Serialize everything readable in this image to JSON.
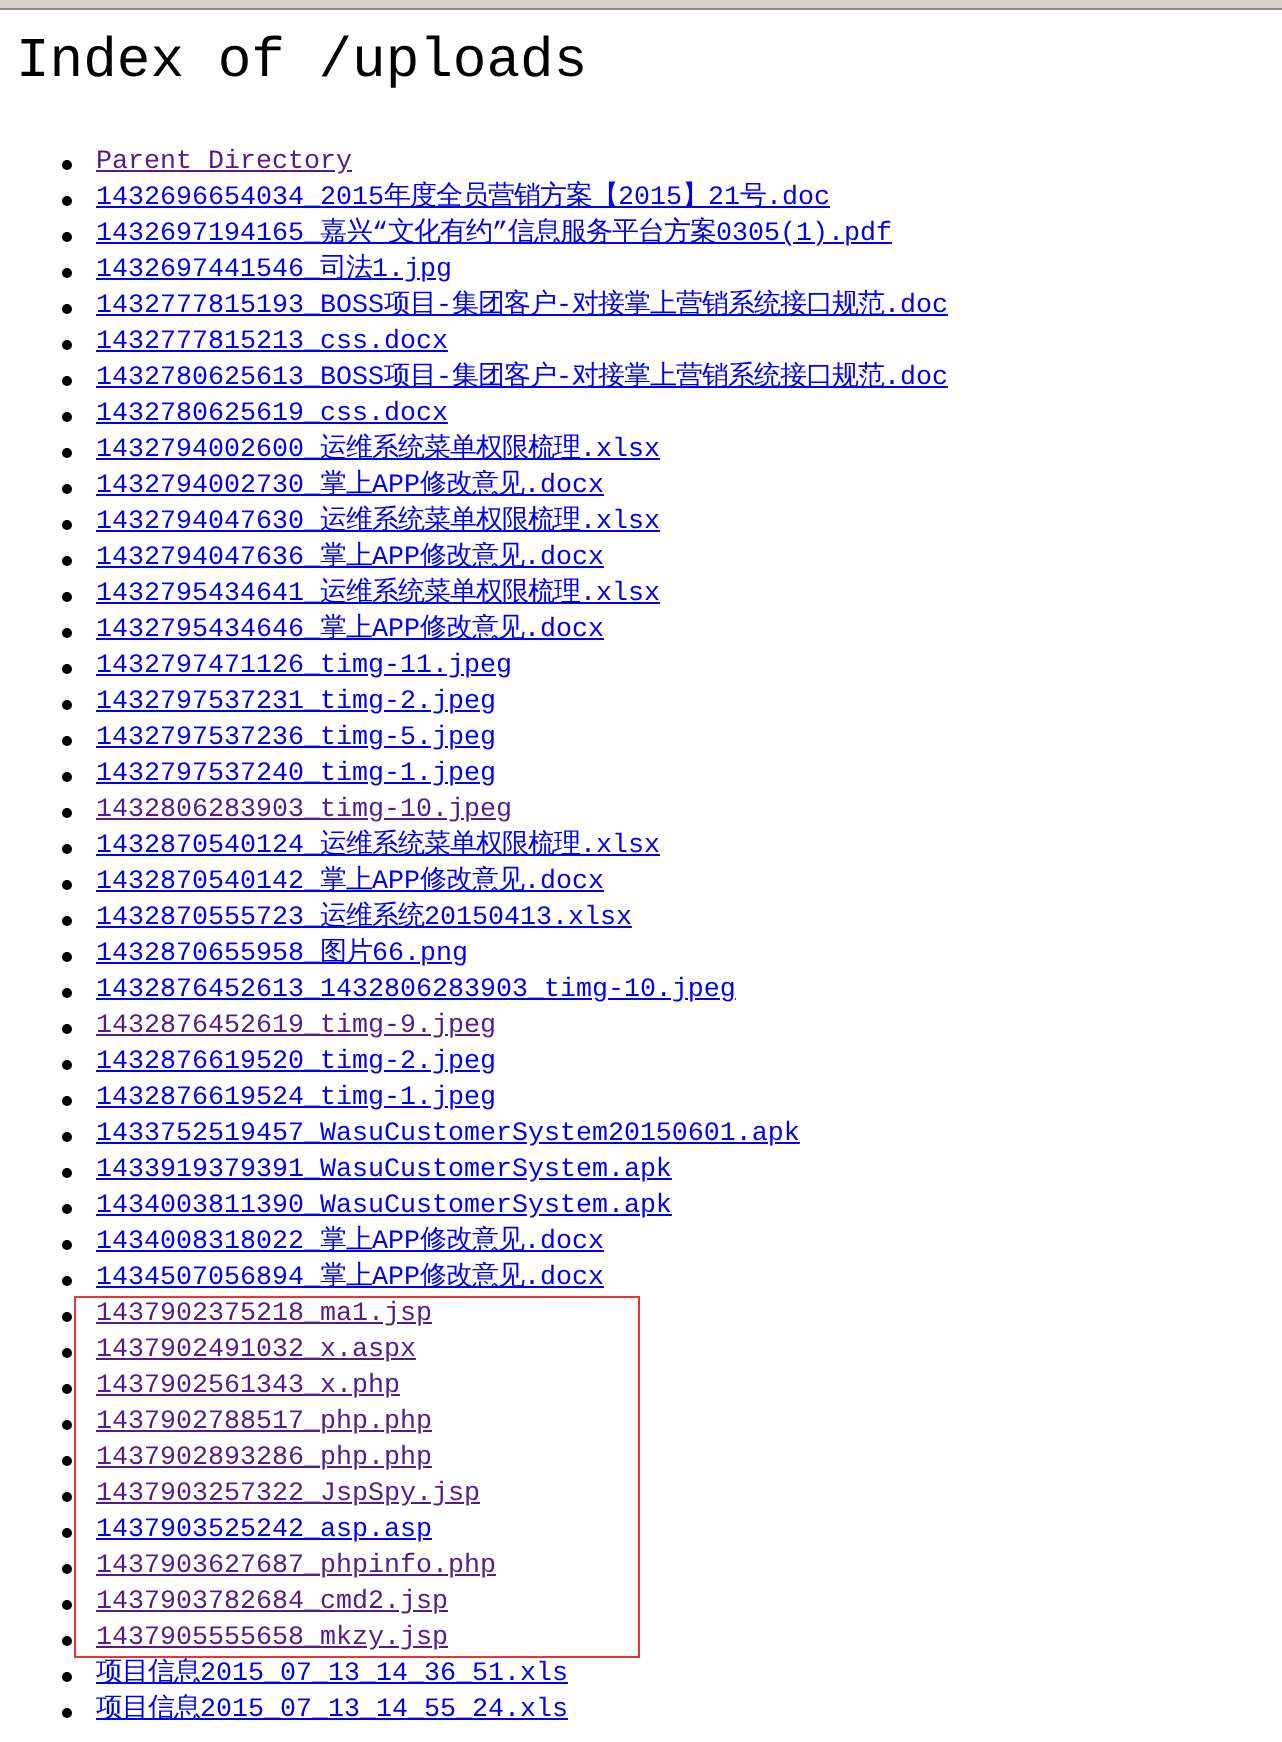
{
  "page": {
    "title": "Index of /uploads"
  },
  "sections": [
    {
      "highlighted": false,
      "links": [
        {
          "label": "Parent Directory",
          "visited": true
        },
        {
          "label": "1432696654034_2015年度全员营销方案【2015】21号.doc",
          "visited": false
        },
        {
          "label": "1432697194165_嘉兴“文化有约”信息服务平台方案0305(1).pdf",
          "visited": false
        },
        {
          "label": "1432697441546_司法1.jpg",
          "visited": false
        },
        {
          "label": "1432777815193_BOSS项目-集团客户-对接掌上营销系统接口规范.doc",
          "visited": false
        },
        {
          "label": "1432777815213_css.docx",
          "visited": false
        },
        {
          "label": "1432780625613_BOSS项目-集团客户-对接掌上营销系统接口规范.doc",
          "visited": false
        },
        {
          "label": "1432780625619_css.docx",
          "visited": false
        },
        {
          "label": "1432794002600_运维系统菜单权限梳理.xlsx",
          "visited": false
        },
        {
          "label": "1432794002730_掌上APP修改意见.docx",
          "visited": false
        },
        {
          "label": "1432794047630_运维系统菜单权限梳理.xlsx",
          "visited": false
        },
        {
          "label": "1432794047636_掌上APP修改意见.docx",
          "visited": false
        },
        {
          "label": "1432795434641_运维系统菜单权限梳理.xlsx",
          "visited": false
        },
        {
          "label": "1432795434646_掌上APP修改意见.docx",
          "visited": false
        },
        {
          "label": "1432797471126_timg-11.jpeg",
          "visited": false
        },
        {
          "label": "1432797537231_timg-2.jpeg",
          "visited": false
        },
        {
          "label": "1432797537236_timg-5.jpeg",
          "visited": false
        },
        {
          "label": "1432797537240_timg-1.jpeg",
          "visited": false
        },
        {
          "label": "1432806283903_timg-10.jpeg",
          "visited": true
        },
        {
          "label": "1432870540124_运维系统菜单权限梳理.xlsx",
          "visited": false
        },
        {
          "label": "1432870540142_掌上APP修改意见.docx",
          "visited": false
        },
        {
          "label": "1432870555723_运维系统20150413.xlsx",
          "visited": false
        },
        {
          "label": "1432870655958_图片66.png",
          "visited": false
        },
        {
          "label": "1432876452613_1432806283903_timg-10.jpeg",
          "visited": false
        },
        {
          "label": "1432876452619_timg-9.jpeg",
          "visited": true
        },
        {
          "label": "1432876619520_timg-2.jpeg",
          "visited": false
        },
        {
          "label": "1432876619524_timg-1.jpeg",
          "visited": false
        },
        {
          "label": "1433752519457_WasuCustomerSystem20150601.apk",
          "visited": false
        },
        {
          "label": "1433919379391_WasuCustomerSystem.apk",
          "visited": false
        },
        {
          "label": "1434003811390_WasuCustomerSystem.apk",
          "visited": false
        },
        {
          "label": "1434008318022_掌上APP修改意见.docx",
          "visited": false
        },
        {
          "label": "1434507056894_掌上APP修改意见.docx",
          "visited": false
        }
      ]
    },
    {
      "highlighted": true,
      "links": [
        {
          "label": "1437902375218_ma1.jsp",
          "visited": true
        },
        {
          "label": "1437902491032_x.aspx",
          "visited": true
        },
        {
          "label": "1437902561343_x.php",
          "visited": true
        },
        {
          "label": "1437902788517_php.php",
          "visited": true
        },
        {
          "label": "1437902893286_php.php",
          "visited": true
        },
        {
          "label": "1437903257322_JspSpy.jsp",
          "visited": true
        },
        {
          "label": "1437903525242_asp.asp",
          "visited": false
        },
        {
          "label": "1437903627687_phpinfo.php",
          "visited": true
        },
        {
          "label": "1437903782684_cmd2.jsp",
          "visited": true
        },
        {
          "label": "1437905555658_mkzy.jsp",
          "visited": true
        }
      ]
    },
    {
      "highlighted": false,
      "links": [
        {
          "label": "项目信息2015_07_13_14_36_51.xls",
          "visited": false
        },
        {
          "label": "项目信息2015_07_13_14_55_24.xls",
          "visited": false
        }
      ]
    }
  ]
}
